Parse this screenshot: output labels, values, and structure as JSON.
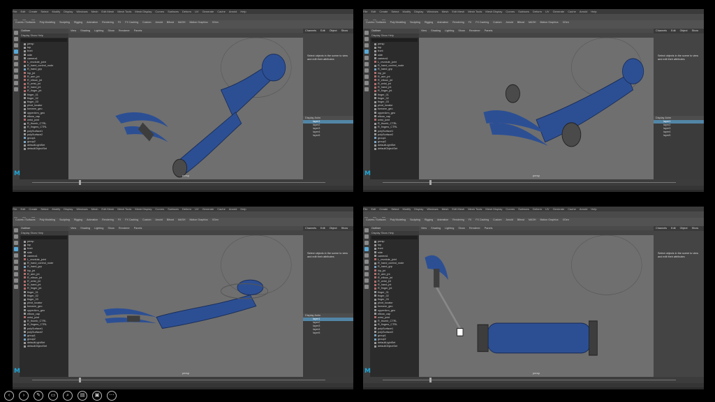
{
  "menus": [
    "File",
    "Edit",
    "Create",
    "Select",
    "Modify",
    "Display",
    "Windows",
    "Mesh",
    "Edit Mesh",
    "Mesh Tools",
    "Mesh Display",
    "Curves",
    "Surfaces",
    "Deform",
    "UV",
    "Generate",
    "Cache",
    "Arnold",
    "Help"
  ],
  "shelf_tabs": [
    "Curves / Surfaces",
    "Poly Modeling",
    "Sculpting",
    "Rigging",
    "Animation",
    "Rendering",
    "FX",
    "FX Caching",
    "Custom",
    "Arnold",
    "Bifrost",
    "MASH",
    "Motion Graphics",
    "XGen"
  ],
  "outliner": {
    "tabs": [
      "Outliner",
      "Tool Settings"
    ],
    "menu": [
      "Display",
      "Show",
      "Help"
    ],
    "items": [
      "persp",
      "top",
      "front",
      "side",
      "camera1",
      "L_revolute_joint",
      "R_hand_control_node",
      "R_hand_grp",
      "hip_jnt",
      "R_arm_jnt",
      "R_elbow_jnt",
      "R_wrist_jnt",
      "R_hand_jnt",
      "R_finger_jnt",
      "finger_01",
      "finger_02",
      "finger_03",
      "pivot_locator",
      "forearm_geo",
      "upperArm_geo",
      "elbow_cap",
      "wrist_joint",
      "R_thumb_CTRL",
      "R_fingers_CTRL",
      "polySurface1",
      "polySurface2",
      "group1",
      "group2",
      "defaultLightSet",
      "defaultObjectSet"
    ]
  },
  "viewport": {
    "menu": [
      "View",
      "Shading",
      "Lighting",
      "Show",
      "Renderer",
      "Panels"
    ],
    "camera_label": "persp"
  },
  "attribute_editor": {
    "tabs": [
      "Channels",
      "Edit",
      "Object",
      "Show"
    ],
    "message": "Select objects in the scene to view and edit their attributes",
    "layer_tabs": [
      "Display",
      "Anim"
    ],
    "layer_menu": [
      "Layers",
      "Options",
      "Help"
    ],
    "layers": [
      "layer1",
      "layer2",
      "layer3",
      "layer4",
      "layer5"
    ]
  },
  "command_line": {
    "label": "MEL"
  },
  "logo": "M",
  "taskbar": {
    "icons": [
      "back-icon",
      "forward-icon",
      "pen-icon",
      "slideshow-icon",
      "zoom-icon",
      "subtitles-icon",
      "camera-icon",
      "more-icon"
    ],
    "glyphs": [
      "‹",
      "›",
      "✎",
      "▭",
      "⌕",
      "▤",
      "▣",
      "⋯"
    ]
  },
  "colors": {
    "accent": "#1fa6d8",
    "model": "#2c4f94"
  }
}
